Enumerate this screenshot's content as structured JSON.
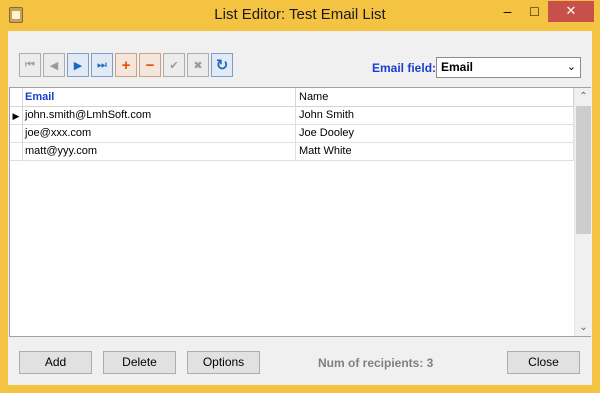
{
  "window": {
    "title": "List Editor: Test Email List",
    "minimize_glyph": "–",
    "maximize_glyph": "□",
    "close_glyph": "✕"
  },
  "toolbar": {
    "buttons": [
      {
        "name": "first-record",
        "icon": "first-icon",
        "glyph": "⏮"
      },
      {
        "name": "prior-record",
        "icon": "prior-icon",
        "glyph": "◀"
      },
      {
        "name": "next-record",
        "icon": "next-icon",
        "glyph": "▶"
      },
      {
        "name": "last-record",
        "icon": "last-icon",
        "glyph": "⏭"
      },
      {
        "name": "insert-record",
        "icon": "plus-icon",
        "glyph": "+"
      },
      {
        "name": "delete-record",
        "icon": "minus-icon",
        "glyph": "−"
      },
      {
        "name": "post-edit",
        "icon": "check-icon",
        "glyph": "✔"
      },
      {
        "name": "cancel-edit",
        "icon": "cancel-icon",
        "glyph": "✖"
      },
      {
        "name": "refresh-data",
        "icon": "refresh-icon",
        "glyph": "↻"
      }
    ]
  },
  "email_field": {
    "label": "Email field:",
    "value": "Email"
  },
  "grid": {
    "columns": [
      "Email",
      "Name"
    ],
    "rows": [
      {
        "email": "john.smith@LmhSoft.com",
        "name": "John Smith",
        "current": true
      },
      {
        "email": "joe@xxx.com",
        "name": "Joe Dooley",
        "current": false
      },
      {
        "email": "matt@yyy.com",
        "name": "Matt White",
        "current": false
      }
    ],
    "current_row_glyph": "▶"
  },
  "footer": {
    "add_label": "Add",
    "delete_label": "Delete",
    "options_label": "Options",
    "recipients_text": "Num of recipients: 3",
    "close_label": "Close"
  },
  "colors": {
    "title_bar": "#f5c342",
    "accent_blue": "#1a3fcf",
    "close_button": "#c7504a"
  }
}
